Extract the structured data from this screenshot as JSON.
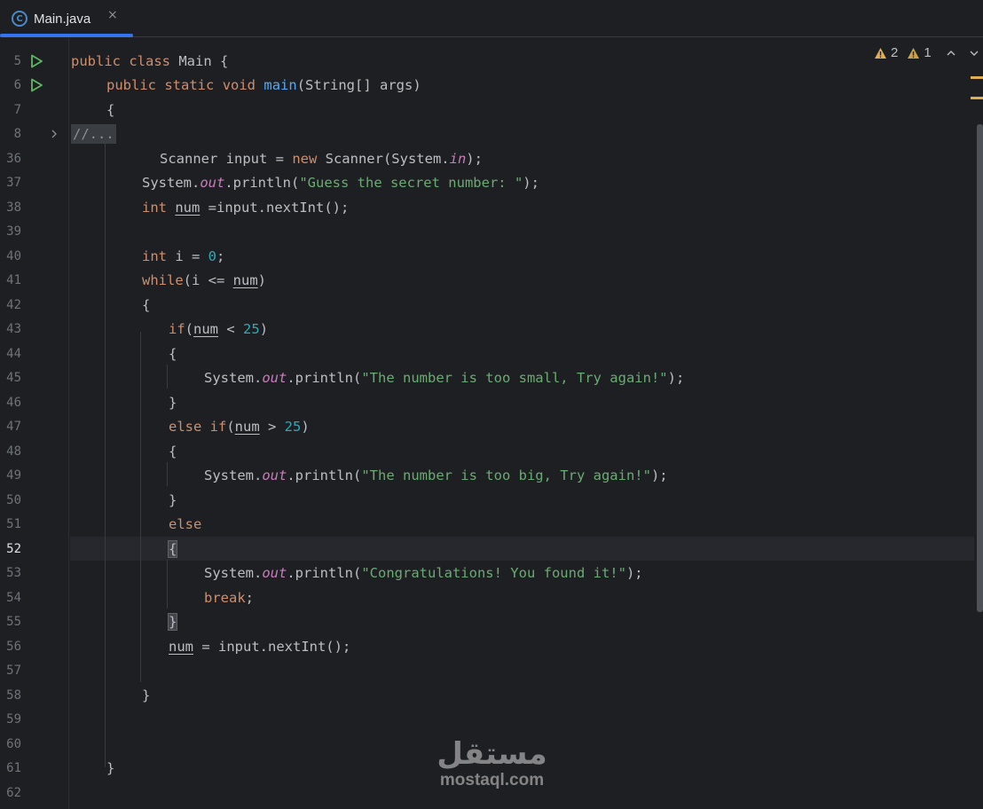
{
  "tab": {
    "title": "Main.java",
    "icon": "java-class-icon",
    "close": "×"
  },
  "inspections": {
    "warnings": "2",
    "weak_warnings": "1",
    "up": "^",
    "down": "⌄"
  },
  "gutter": {
    "line_numbers": [
      "5",
      "6",
      "7",
      "8",
      "36",
      "37",
      "38",
      "39",
      "40",
      "41",
      "42",
      "43",
      "44",
      "45",
      "46",
      "47",
      "48",
      "49",
      "50",
      "51",
      "52",
      "53",
      "54",
      "55",
      "56",
      "57",
      "58",
      "59",
      "60",
      "61",
      "62"
    ],
    "active_line": "52"
  },
  "code": {
    "l5": {
      "kw1": "public",
      "kw2": "class",
      "rest": " Main {"
    },
    "l6": {
      "kw1": "public",
      "kw2": "static",
      "kw3": "void",
      "fn": "main",
      "rest": "(String[] args)"
    },
    "l7": {
      "text": "{"
    },
    "l8": {
      "folded": "//..."
    },
    "l36": {
      "pre": "Scanner input = ",
      "kw": "new",
      "mid": " Scanner(System.",
      "it": "in",
      "post": ");"
    },
    "l37": {
      "pre": "System.",
      "it": "out",
      "mid": ".println(",
      "str": "\"Guess the secret number: \"",
      "post": ");"
    },
    "l38": {
      "kw": "int",
      "var": "num",
      "post": " =input.nextInt();"
    },
    "l40": {
      "kw": "int",
      "mid": " i = ",
      "num": "0",
      "post": ";"
    },
    "l41": {
      "kw": "while",
      "mid": "(i <= ",
      "var": "num",
      "post": ")"
    },
    "l42": {
      "text": "{"
    },
    "l43": {
      "kw": "if",
      "pre": "(",
      "var": "num",
      "mid": " < ",
      "num": "25",
      "post": ")"
    },
    "l44": {
      "text": "{"
    },
    "l45": {
      "pre": "System.",
      "it": "out",
      "mid": ".println(",
      "str": "\"The number is too small, Try again!\"",
      "post": ");"
    },
    "l46": {
      "text": "}"
    },
    "l47": {
      "kw": "else if",
      "pre": "(",
      "var": "num",
      "mid": " > ",
      "num": "25",
      "post": ")"
    },
    "l48": {
      "text": "{"
    },
    "l49": {
      "pre": "System.",
      "it": "out",
      "mid": ".println(",
      "str": "\"The number is too big, Try again!\"",
      "post": ");"
    },
    "l50": {
      "text": "}"
    },
    "l51": {
      "kw": "else"
    },
    "l52": {
      "text": "{"
    },
    "l53": {
      "pre": "System.",
      "it": "out",
      "mid": ".println(",
      "str": "\"Congratulations! You found it!\"",
      "post": ");"
    },
    "l54": {
      "kw": "break",
      "post": ";"
    },
    "l55": {
      "text": "}"
    },
    "l56": {
      "var": "num",
      "post": " = input.nextInt();"
    },
    "l58": {
      "text": "}"
    },
    "l61": {
      "text": "}"
    }
  },
  "watermark": {
    "arabic": "مستقل",
    "latin": "mostaql.com"
  },
  "colors": {
    "keyword": "#cf8e6d",
    "function": "#56a8f5",
    "string": "#6aab73",
    "number": "#2aacb8",
    "field": "#c77dbb",
    "accent": "#3574f0",
    "warning": "#e0b050"
  }
}
